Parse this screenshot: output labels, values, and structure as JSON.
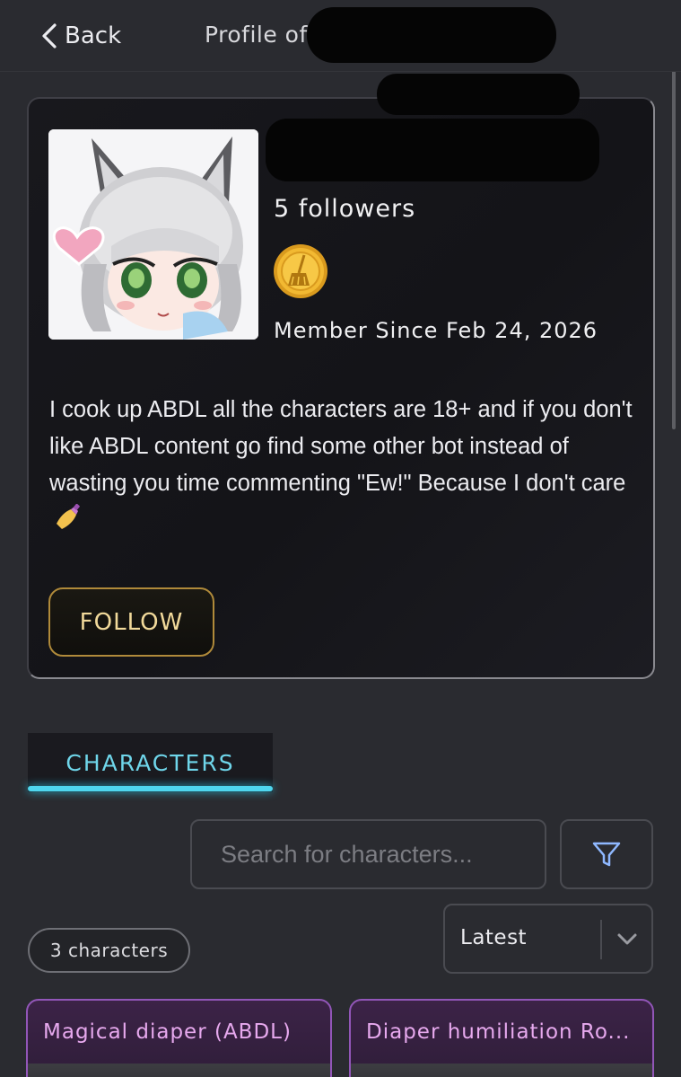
{
  "header": {
    "back_label": "Back",
    "title_prefix": "Profile of"
  },
  "profile": {
    "followers": "5 followers",
    "badge_icon": "gold-coin-broom-icon",
    "member_since": "Member Since Feb 24, 2026",
    "bio": "I cook up ABDL all the characters are 18+ and if you don't like ABDL content go find some other bot instead of wasting you time commenting \"Ew!\" Because I don't care",
    "bio_emoji": "nail-polish-emoji",
    "follow_label": "FOLLOW"
  },
  "tabs": [
    {
      "label": "CHARACTERS",
      "active": true
    }
  ],
  "search": {
    "placeholder": "Search for characters...",
    "filter_icon": "funnel-icon"
  },
  "list": {
    "count_label": "3 characters",
    "sort_value": "Latest"
  },
  "characters": [
    {
      "title": "Magical diaper (ABDL)"
    },
    {
      "title": "Diaper humiliation Ro..."
    }
  ],
  "colors": {
    "background": "#2a2b30",
    "accent_cyan": "#4fd6ee",
    "follow_gold": "#b08a3a",
    "card_purple": "#9256b8"
  }
}
